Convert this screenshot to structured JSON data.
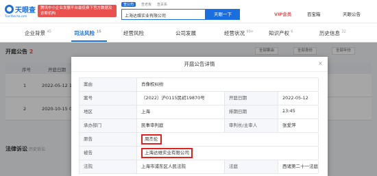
{
  "header": {
    "logo_text": "天眼查",
    "logo_sub": "TianYancha.com",
    "promo": "腾讯中小企业发展平台最低费下官方数据及诊断机构",
    "search_tabs": [
      "查公司",
      "查老板",
      "查关系"
    ],
    "search_value": "上海达维实业有限公司",
    "search_button": "天眼一下",
    "vip": "VIP会员",
    "app": "百宝箱",
    "user": "天眼公告"
  },
  "nav": {
    "items": [
      {
        "label": "企业背景",
        "count": "45"
      },
      {
        "label": "司法风险",
        "count": "15"
      },
      {
        "label": "经营风险",
        "count": ""
      },
      {
        "label": "公司发展",
        "count": ""
      },
      {
        "label": "经营状况",
        "count": "99+"
      },
      {
        "label": "知识产权",
        "count": "6"
      },
      {
        "label": "历史信息",
        "count": "32"
      }
    ]
  },
  "section": {
    "title": "开庭公告",
    "count": "2",
    "filters": [
      "全部案由",
      "全部身份",
      "全部年份"
    ],
    "headers": [
      "序号",
      "开庭日期"
    ],
    "rows": [
      {
        "no": "1",
        "date": "2022-05-12 1"
      },
      {
        "no": "2",
        "date": "2020-10-15 0"
      }
    ],
    "lawsuit_title": "法律诉讼",
    "lawsuit_tip": "历史诉讼"
  },
  "modal": {
    "title": "开庭公告详情",
    "close": "×",
    "rows": [
      {
        "label": "案由",
        "value": "肖像权纠纷"
      },
      {
        "label": "案号",
        "value": "（2022）沪0115民初19870号",
        "label2": "开庭日期",
        "value2": "2022-05-12 13:45"
      },
      {
        "label": "地区",
        "value": "上海",
        "label2": "排期日期",
        "value2": "-"
      },
      {
        "label": "承办部门",
        "value": "民事审判庭",
        "label2": "审判长/主审人",
        "value2": "张爱萍"
      },
      {
        "label": "原告",
        "value": "周杰伦"
      },
      {
        "label": "被告",
        "value": "上海达维实业有限公司"
      },
      {
        "label": "法院",
        "value": "上海市浦东区人民法院",
        "label2": "法庭",
        "value2": "西诸第二十一法庭"
      }
    ]
  },
  "colors": {
    "brand": "#1a6fe0",
    "highlight": "#e0201f"
  }
}
